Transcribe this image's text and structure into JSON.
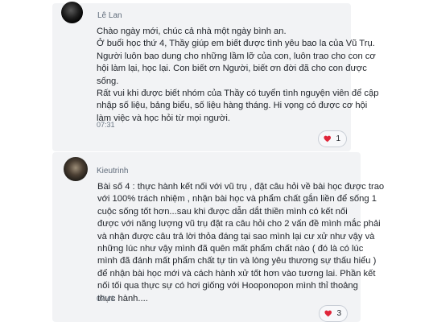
{
  "comments": [
    {
      "author": "Lê Lan",
      "lines": [
        "Chào ngày mới, chúc cả nhà một ngày bình an.",
        "Ở buổi học thứ 4, Thầy giúp em biết được tình yêu bao la của Vũ Trụ.",
        "Người luôn bao dung cho những lầm lỡ của con, luôn trao cho con cơ",
        "hội làm lại, học lại. Con biết ơn Người, biết ơn đời đã cho con được",
        "sống.",
        "Rất vui khi được biết nhóm của Thầy có tuyển tình nguyện viên để cập",
        "nhập số liệu, bảng biểu, số liệu hàng tháng. Hi vọng có được cơ hội",
        "làm việc và học hỏi từ mọi người."
      ],
      "time": "07:31",
      "reaction": {
        "icon": "heart-icon",
        "count": "1",
        "color": "#e0263a"
      }
    },
    {
      "author": "Kieutrinh",
      "lines": [
        "Bài số 4 : thực hành kết nối với vũ trụ , đặt câu hỏi về bài học được trao",
        "với 100% trách nhiệm , nhận bài học và phẩm chất gắn liền để sống 1",
        "cuộc sống tốt hơn...sau khi được dẫn dắt thiền mình có kết nối",
        "được với năng lượng vũ trụ đặt ra câu hỏi cho 2 vấn đề mình mắc phải",
        "và nhận được câu trả lời thỏa đáng tại sao mình lại cư xử như vậy và",
        "những lúc như vậy mình đã quên mất phẩm chất nào ( đó là có lúc",
        "mình đã đánh mất phẩm chất tự tin và lòng yêu thương sự thấu hiểu )",
        "để nhận bài học mới và cách hành xử tốt hơn vào tương lai. Phần kết",
        "nối tối qua thực sự có hơi giống với  Hooponopon mình thỉ thoảng",
        "thực hành...."
      ],
      "time": "07:43",
      "reaction": {
        "icon": "heart-icon",
        "count": "3",
        "color": "#e0263a"
      }
    }
  ]
}
